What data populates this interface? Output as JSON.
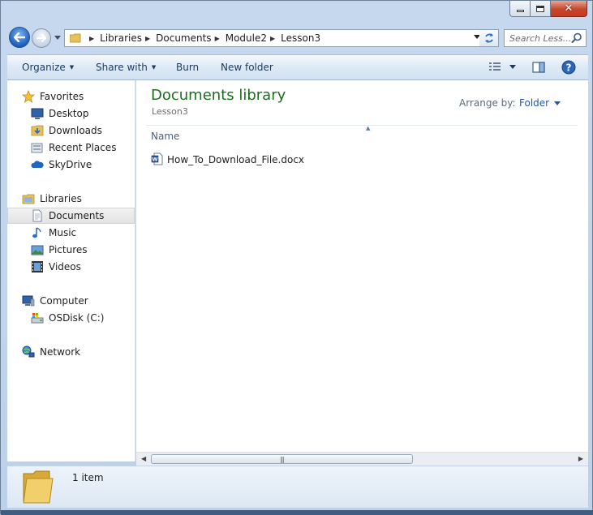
{
  "window": {
    "controls": {
      "minimize": "minimize",
      "maximize": "maximize",
      "close": "close"
    }
  },
  "navigation": {
    "breadcrumb": [
      "Libraries",
      "Documents",
      "Module2",
      "Lesson3"
    ],
    "search_placeholder": "Search Less..."
  },
  "toolbar": {
    "organize": "Organize",
    "share_with": "Share with",
    "burn": "Burn",
    "new_folder": "New folder"
  },
  "sidebar": {
    "favorites": {
      "label": "Favorites",
      "items": [
        "Desktop",
        "Downloads",
        "Recent Places",
        "SkyDrive"
      ]
    },
    "libraries": {
      "label": "Libraries",
      "items": [
        "Documents",
        "Music",
        "Pictures",
        "Videos"
      ],
      "selected": "Documents"
    },
    "computer": {
      "label": "Computer",
      "items": [
        "OSDisk (C:)"
      ]
    },
    "network": {
      "label": "Network"
    }
  },
  "content": {
    "title": "Documents library",
    "subtitle": "Lesson3",
    "arrange_label": "Arrange by:",
    "arrange_value": "Folder",
    "column_name": "Name",
    "files": [
      {
        "name": "How_To_Download_File.docx",
        "icon": "word-document-icon"
      }
    ]
  },
  "details": {
    "count": "1 item"
  },
  "colors": {
    "library_title": "#1a6d1a",
    "link_blue": "#1e5ab4",
    "selection_gray": "#e8e8e8"
  }
}
